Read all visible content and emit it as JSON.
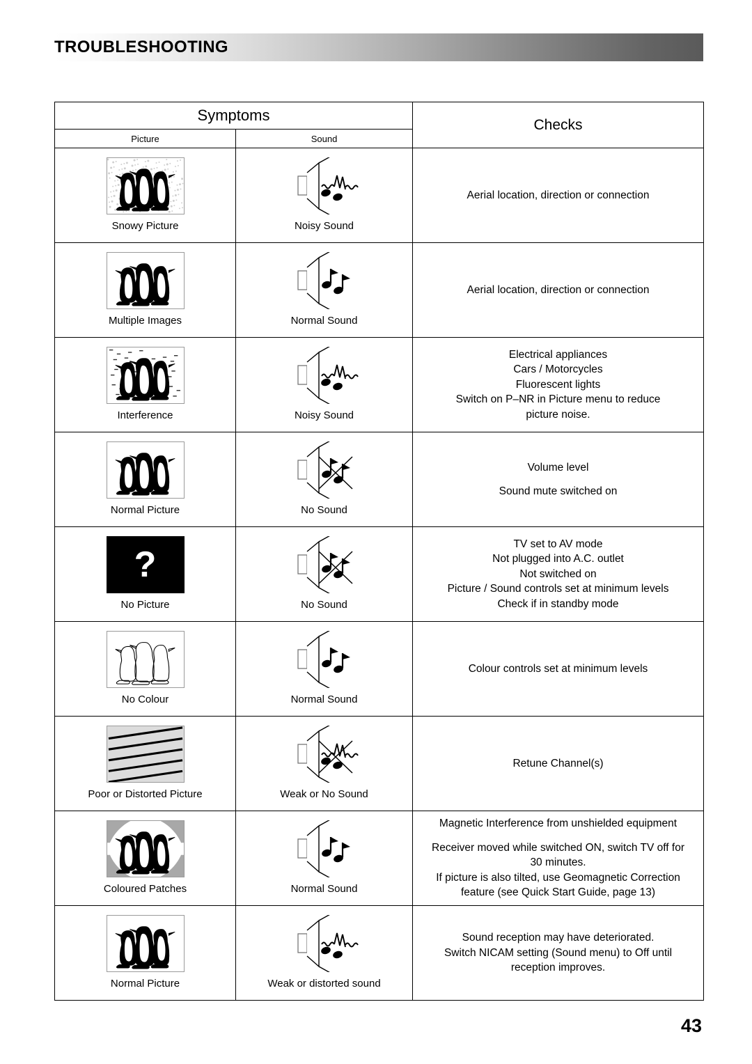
{
  "banner": {
    "title": "TROUBLESHOOTING"
  },
  "page_number": "43",
  "table": {
    "headers": {
      "symptoms": "Symptoms",
      "checks": "Checks",
      "picture": "Picture",
      "sound": "Sound"
    },
    "rows": [
      {
        "picture_icon": "snowy-picture-thumbnail",
        "picture_caption": "Snowy Picture",
        "sound_icon": "speaker-noisy-icon",
        "sound_caption": "Noisy Sound",
        "checks": [
          "Aerial location, direction or connection"
        ]
      },
      {
        "picture_icon": "multiple-images-thumbnail",
        "picture_caption": "Multiple Images",
        "sound_icon": "speaker-normal-icon",
        "sound_caption": "Normal Sound",
        "checks": [
          "Aerial location, direction or connection"
        ]
      },
      {
        "picture_icon": "interference-thumbnail",
        "picture_caption": "Interference",
        "sound_icon": "speaker-noisy-icon",
        "sound_caption": "Noisy Sound",
        "checks": [
          "Electrical appliances",
          "Cars / Motorcycles",
          "Fluorescent lights",
          "Switch on P–NR in Picture menu to reduce",
          "picture noise."
        ]
      },
      {
        "picture_icon": "normal-picture-thumbnail",
        "picture_caption": "Normal Picture",
        "sound_icon": "speaker-muted-icon",
        "sound_caption": "No Sound",
        "checks": [
          "Volume level",
          "",
          "Sound mute switched on"
        ]
      },
      {
        "picture_icon": "no-picture-thumbnail",
        "picture_caption": "No Picture",
        "sound_icon": "speaker-muted-icon",
        "sound_caption": "No Sound",
        "checks": [
          "TV set to AV mode",
          "Not plugged into A.C. outlet",
          "Not switched on",
          "Picture / Sound controls set at minimum levels",
          "Check if in standby mode"
        ]
      },
      {
        "picture_icon": "no-colour-thumbnail",
        "picture_caption": "No Colour",
        "sound_icon": "speaker-normal-icon",
        "sound_caption": "Normal Sound",
        "checks": [
          "Colour controls set at minimum levels"
        ]
      },
      {
        "picture_icon": "distorted-picture-thumbnail",
        "picture_caption": "Poor or Distorted Picture",
        "sound_icon": "speaker-weak-muted-icon",
        "sound_caption": "Weak or No Sound",
        "checks": [
          "Retune Channel(s)"
        ]
      },
      {
        "picture_icon": "coloured-patches-thumbnail",
        "picture_caption": "Coloured Patches",
        "sound_icon": "speaker-normal-icon",
        "sound_caption": "Normal Sound",
        "checks": [
          "Magnetic Interference from unshielded equipment",
          "",
          "Receiver moved while switched ON, switch TV off for",
          "30 minutes.",
          "If picture is also tilted, use Geomagnetic Correction",
          "feature (see Quick Start Guide, page 13)"
        ]
      },
      {
        "picture_icon": "normal-picture-thumbnail",
        "picture_caption": "Normal Picture",
        "sound_icon": "speaker-distorted-icon",
        "sound_caption": "Weak or distorted sound",
        "checks": [
          "Sound reception may have deteriorated.",
          "Switch NICAM setting (Sound menu) to Off until",
          "reception improves."
        ]
      }
    ]
  },
  "colors": {
    "banner_start": "#ffffff",
    "banner_end": "#5a5a5a",
    "line": "#000000",
    "thumb_border": "#9a9a9a",
    "patch_gray": "#a8a8a8",
    "distort_gray": "#dcdcdc"
  }
}
